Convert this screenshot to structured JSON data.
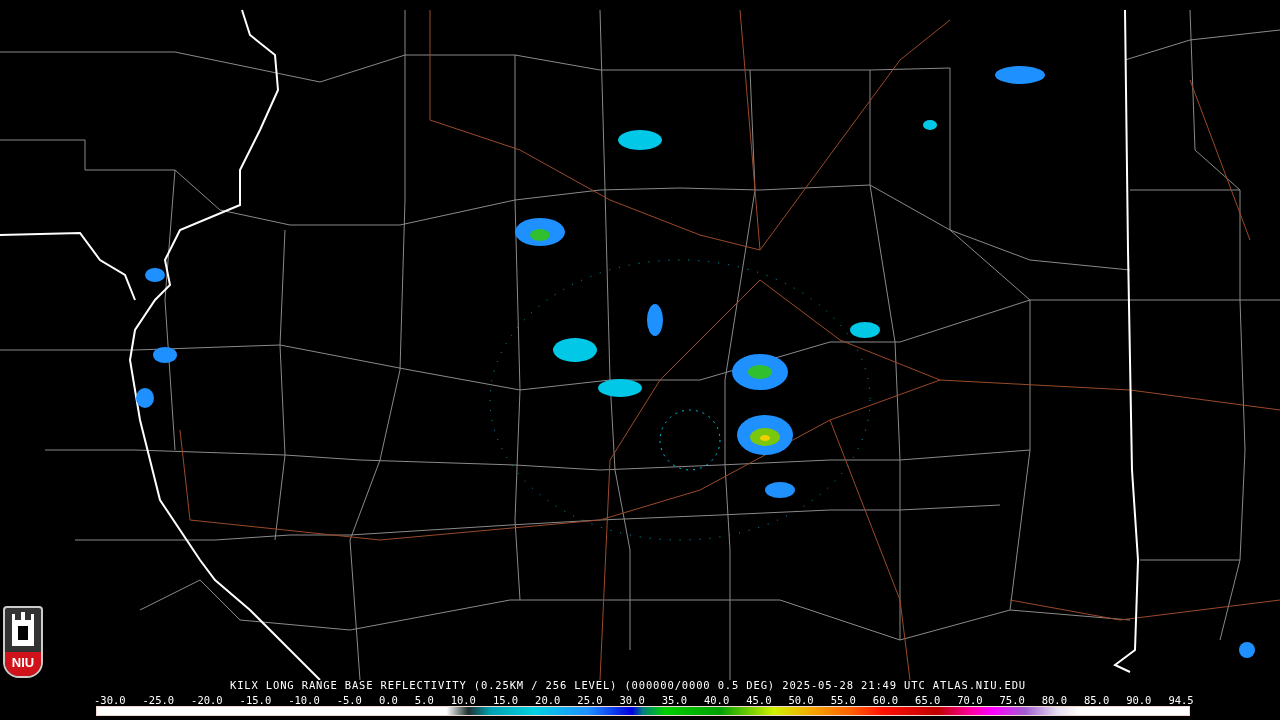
{
  "logo": {
    "text": "NIU"
  },
  "title": "KILX LONG RANGE BASE REFLECTIVITY (0.25KM / 256 LEVEL) (000000/0000 0.5 DEG) 2025-05-28 21:49 UTC  ATLAS.NIU.EDU",
  "scale": {
    "labels": [
      "-30.0",
      "-25.0",
      "-20.0",
      "-15.0",
      "-10.0",
      "-5.0",
      "0.0",
      "5.0",
      "10.0",
      "15.0",
      "20.0",
      "25.0",
      "30.0",
      "35.0",
      "40.0",
      "45.0",
      "50.0",
      "55.0",
      "60.0",
      "65.0",
      "70.0",
      "75.0",
      "80.0",
      "85.0",
      "90.0",
      "94.5"
    ]
  }
}
